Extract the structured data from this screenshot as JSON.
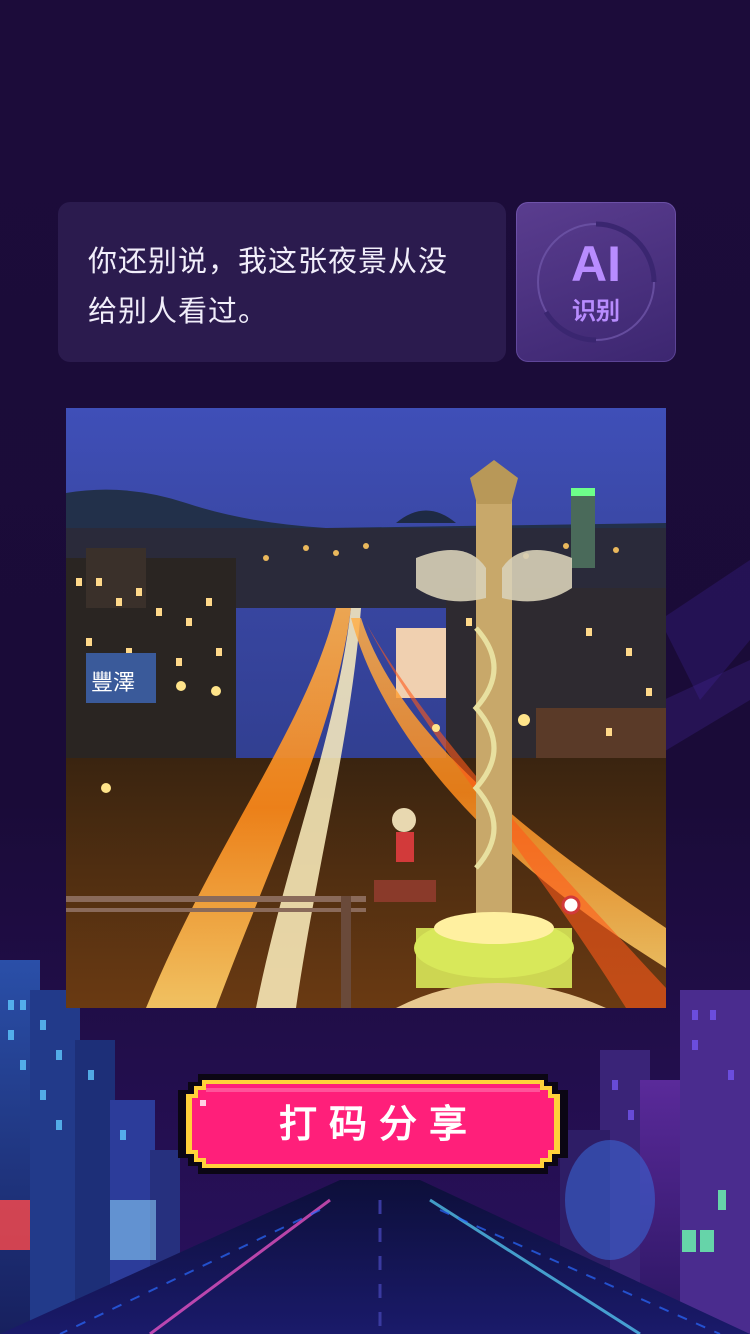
{
  "message": {
    "text": "你还别说，我这张夜景从没给别人看过。"
  },
  "ai_button": {
    "main": "AI",
    "sub": "识别"
  },
  "photo": {
    "billboard_text": "豐澤"
  },
  "share_button": {
    "label": "打码分享"
  },
  "colors": {
    "background": "#1a0b38",
    "bubble": "#2b1b4e",
    "ai_accent": "#b88cff",
    "share_pink": "#ff1f7a",
    "share_gold": "#ffd23a"
  }
}
